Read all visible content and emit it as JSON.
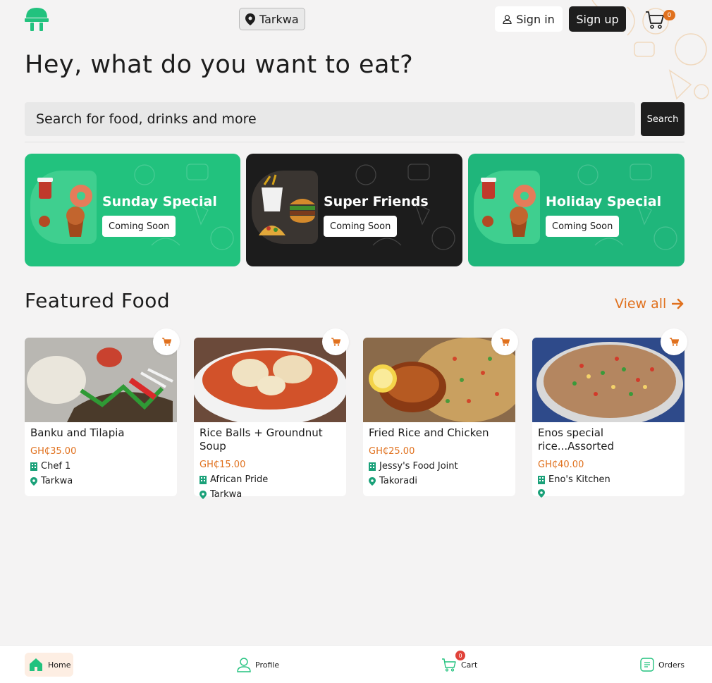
{
  "header": {
    "location": "Tarkwa",
    "signin_label": "Sign in",
    "signup_label": "Sign up",
    "cart_count": "0"
  },
  "hero": {
    "title": "Hey, what do you want to eat?"
  },
  "search": {
    "placeholder": "Search for food, drinks and more",
    "button_label": "Search"
  },
  "promos": [
    {
      "title": "Sunday Special",
      "button_label": "Coming Soon"
    },
    {
      "title": "Super Friends",
      "button_label": "Coming Soon"
    },
    {
      "title": "Holiday Special",
      "button_label": "Coming Soon"
    }
  ],
  "featured": {
    "title": "Featured Food",
    "view_all_label": "View all",
    "items": [
      {
        "name": "Banku and Tilapia",
        "price": "GH₵35.00",
        "vendor": "Chef 1",
        "location": "Tarkwa"
      },
      {
        "name": "Rice Balls + Groundnut Soup",
        "price": "GH₵15.00",
        "vendor": "African Pride",
        "location": "Tarkwa"
      },
      {
        "name": "Fried Rice and Chicken",
        "price": "GH₵25.00",
        "vendor": "Jessy's Food Joint",
        "location": "Takoradi"
      },
      {
        "name": "Enos special rice...Assorted",
        "price": "GH₵40.00",
        "vendor": "Eno's Kitchen",
        "location": ""
      }
    ]
  },
  "bottom_nav": {
    "home": "Home",
    "profile": "Profile",
    "cart": "Cart",
    "cart_count": "0",
    "orders": "Orders"
  },
  "colors": {
    "accent_orange": "#e0711e",
    "brand_green": "#22c27e",
    "dark": "#1e1e1e",
    "icon_green": "#1aa179"
  }
}
